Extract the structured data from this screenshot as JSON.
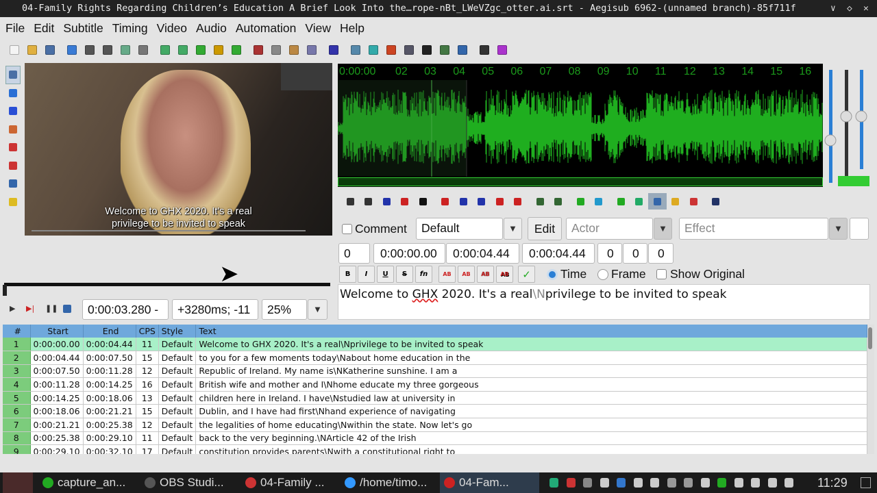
{
  "window": {
    "title": "04-Family Rights Regarding Children’s Education A Brief Look Into the…rope-nBt_LWeVZgc_otter.ai.srt - Aegisub 6962-(unnamed branch)-85f711f",
    "controls": [
      "∨",
      "◇",
      "✕"
    ]
  },
  "menu": [
    "File",
    "Edit",
    "Subtitle",
    "Timing",
    "Video",
    "Audio",
    "Automation",
    "View",
    "Help"
  ],
  "toolbar": {
    "icons": [
      {
        "name": "new-file-icon",
        "color": "#f4f4f4"
      },
      {
        "name": "open-file-icon",
        "color": "#e0b040"
      },
      {
        "name": "save-icon",
        "color": "#4a6fa5"
      },
      {
        "name": "separator",
        "color": ""
      },
      {
        "name": "jump-to-icon",
        "color": "#3a7bd5"
      },
      {
        "name": "find-icon",
        "color": "#555"
      },
      {
        "name": "find-replace-icon",
        "color": "#555"
      },
      {
        "name": "attachments-icon",
        "color": "#6a8"
      },
      {
        "name": "fonts-collector-icon",
        "color": "#777"
      },
      {
        "name": "separator",
        "color": ""
      },
      {
        "name": "open-video-icon",
        "color": "#4a6"
      },
      {
        "name": "close-video-icon",
        "color": "#4a6"
      },
      {
        "name": "select-visible-icon",
        "color": "#3a3"
      },
      {
        "name": "snap-video-icon",
        "color": "#c90"
      },
      {
        "name": "video-details-icon",
        "color": "#3a3"
      },
      {
        "name": "separator",
        "color": ""
      },
      {
        "name": "styles-manager-icon",
        "color": "#a33"
      },
      {
        "name": "properties-icon",
        "color": "#888"
      },
      {
        "name": "edit-style-icon",
        "color": "#b84"
      },
      {
        "name": "translation-assistant-icon",
        "color": "#77a"
      },
      {
        "name": "separator",
        "color": ""
      },
      {
        "name": "resample-icon",
        "color": "#33a"
      },
      {
        "name": "separator",
        "color": ""
      },
      {
        "name": "timing-postprocess-icon",
        "color": "#58a"
      },
      {
        "name": "kanji-timer-icon",
        "color": "#3aa"
      },
      {
        "name": "shift-times-icon",
        "color": "#c42"
      },
      {
        "name": "select-lines-icon",
        "color": "#556"
      },
      {
        "name": "timing-icon",
        "color": "#222"
      },
      {
        "name": "spell-check-icon",
        "color": "#474"
      },
      {
        "name": "assistant-icon",
        "color": "#36a"
      },
      {
        "name": "separator",
        "color": ""
      },
      {
        "name": "options-icon",
        "color": "#333"
      },
      {
        "name": "automation-icon",
        "color": "#a3c"
      }
    ]
  },
  "left_tools": [
    {
      "name": "standard-tool-icon",
      "color": "#4a6fa5"
    },
    {
      "name": "drag-tool-icon",
      "color": "#2a6fd5"
    },
    {
      "name": "rotate-z-icon",
      "color": "#2a4fd5"
    },
    {
      "name": "rotate-xy-icon",
      "color": "#c63"
    },
    {
      "name": "scale-icon",
      "color": "#c33"
    },
    {
      "name": "clip-rect-icon",
      "color": "#c33"
    },
    {
      "name": "vector-clip-icon",
      "color": "#36a"
    },
    {
      "name": "help-icon",
      "color": "#db2"
    }
  ],
  "video": {
    "subtitle_line1": "Welcome to GHX 2020. It's a real",
    "subtitle_line2": "privilege to be invited to speak",
    "time_display": "0:00:03.280 -",
    "offset_display": "+3280ms; -11",
    "zoom": "25%",
    "playback_position": 0.01
  },
  "audio": {
    "timeline_labels": [
      "0:00:00",
      "02",
      "03",
      "04",
      "05",
      "06",
      "07",
      "08",
      "09",
      "10",
      "11",
      "12",
      "13",
      "14",
      "15",
      "16"
    ],
    "waveform_color": "#1fae1f",
    "toolbar_icons": [
      "prev-line-icon",
      "next-line-icon",
      "play-selection-icon",
      "play-line-icon",
      "stop-icon",
      "play-before-icon",
      "play-after-icon",
      "play-start-icon",
      "play-end-icon",
      "play-to-end-icon",
      "snap-start-icon",
      "snap-end-icon",
      "commit-icon",
      "goto-next-icon",
      "auto-commit-icon",
      "auto-next-icon",
      "auto-scroll-icon",
      "spectrum-icon",
      "karaoke-icon",
      "settings-icon"
    ]
  },
  "editor": {
    "comment_label": "Comment",
    "style": "Default",
    "edit_label": "Edit",
    "actor_placeholder": "Actor",
    "effect_placeholder": "Effect",
    "layer": "0",
    "start": "0:00:00.00",
    "end": "0:00:04.44",
    "duration": "0:00:04.44",
    "margin_l": "0",
    "margin_r": "0",
    "margin_v": "0",
    "format_buttons": [
      "B",
      "I",
      "U",
      "S",
      "fn",
      "AB",
      "AB",
      "AB",
      "AB"
    ],
    "commit": "✓",
    "time_label": "Time",
    "frame_label": "Frame",
    "show_original_label": "Show Original",
    "time_mode": "Time",
    "text_before": "Welcome to ",
    "text_misspelled": "GHX",
    "text_mid": " 2020. It's a real",
    "text_tag": "\\N",
    "text_after": "privilege to be invited to speak"
  },
  "grid": {
    "headers": [
      "#",
      "Start",
      "End",
      "CPS",
      "Style",
      "Text"
    ],
    "selected_row": 1,
    "rows": [
      [
        "1",
        "0:00:00.00",
        "0:00:04.44",
        "11",
        "Default",
        "Welcome to GHX 2020. It's a real\\Nprivilege to be invited to speak"
      ],
      [
        "2",
        "0:00:04.44",
        "0:00:07.50",
        "15",
        "Default",
        "to you for a few moments today\\Nabout home education in the"
      ],
      [
        "3",
        "0:00:07.50",
        "0:00:11.28",
        "12",
        "Default",
        "Republic of Ireland. My name is\\NKatherine sunshine. I am a"
      ],
      [
        "4",
        "0:00:11.28",
        "0:00:14.25",
        "16",
        "Default",
        "British wife and mother and I\\Nhome educate my three gorgeous"
      ],
      [
        "5",
        "0:00:14.25",
        "0:00:18.06",
        "13",
        "Default",
        "children here in Ireland. I have\\Nstudied law at university in"
      ],
      [
        "6",
        "0:00:18.06",
        "0:00:21.21",
        "15",
        "Default",
        "Dublin, and I have had first\\Nhand experience of navigating"
      ],
      [
        "7",
        "0:00:21.21",
        "0:00:25.38",
        "12",
        "Default",
        "the legalities of home educating\\Nwithin the state. Now let's go"
      ],
      [
        "8",
        "0:00:25.38",
        "0:00:29.10",
        "11",
        "Default",
        "back to the very beginning.\\NArticle 42 of the Irish"
      ],
      [
        "9",
        "0:00:29.10",
        "0:00:32.10",
        "17",
        "Default",
        "constitution provides parents\\Nwith a constitutional right to"
      ]
    ]
  },
  "taskbar": {
    "tasks": [
      {
        "label": "capture_an...",
        "color": "#2a2"
      },
      {
        "label": "OBS Studi...",
        "color": "#555"
      },
      {
        "label": "04-Family ...",
        "color": "#c33"
      },
      {
        "label": "/home/timo...",
        "color": "#39f"
      },
      {
        "label": "04-Fam...",
        "color": "#c22"
      }
    ],
    "clock": "11:29"
  }
}
